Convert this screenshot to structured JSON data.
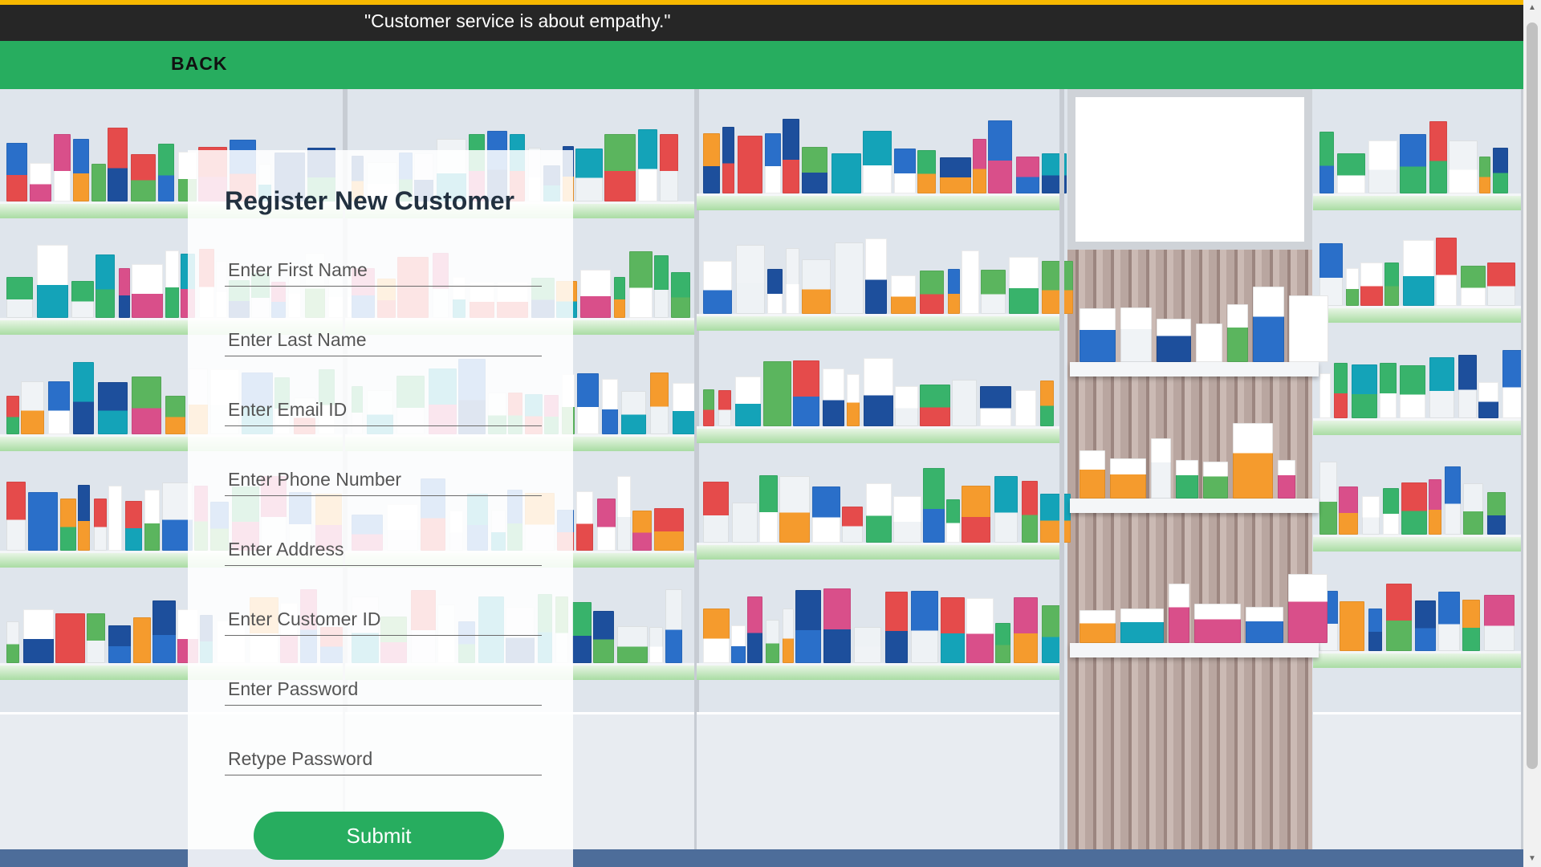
{
  "header": {
    "quote": "\"Customer service is about empathy.\"",
    "back_label": "BACK"
  },
  "form": {
    "title": "Register New Customer",
    "fields": [
      {
        "name": "first-name",
        "placeholder": "Enter First Name",
        "value": ""
      },
      {
        "name": "last-name",
        "placeholder": "Enter Last Name",
        "value": ""
      },
      {
        "name": "email",
        "placeholder": "Enter Email ID",
        "value": ""
      },
      {
        "name": "phone",
        "placeholder": "Enter Phone Number",
        "value": ""
      },
      {
        "name": "address",
        "placeholder": "Enter Address",
        "value": ""
      },
      {
        "name": "customer-id",
        "placeholder": "Enter Customer ID",
        "value": ""
      },
      {
        "name": "password",
        "placeholder": "Enter Password",
        "value": ""
      },
      {
        "name": "retype-password",
        "placeholder": "Retype Password",
        "value": ""
      }
    ],
    "submit_label": "Submit"
  },
  "colors": {
    "accent_green": "#27ad5f",
    "top_bar": "#262626",
    "top_border": "#f6b800"
  }
}
